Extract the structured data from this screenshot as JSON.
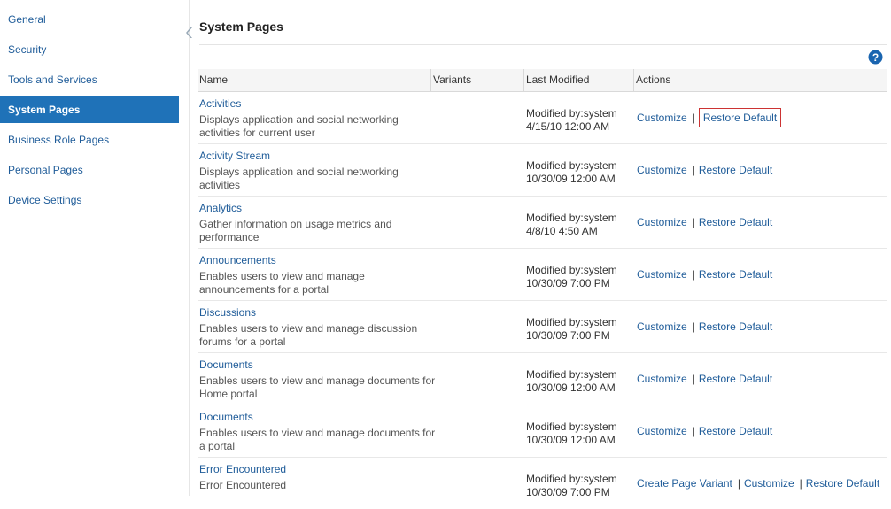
{
  "sidebar": {
    "items": [
      {
        "label": "General",
        "selected": false
      },
      {
        "label": "Security",
        "selected": false
      },
      {
        "label": "Tools and Services",
        "selected": false
      },
      {
        "label": "System Pages",
        "selected": true
      },
      {
        "label": "Business Role Pages",
        "selected": false
      },
      {
        "label": "Personal Pages",
        "selected": false
      },
      {
        "label": "Device Settings",
        "selected": false
      }
    ]
  },
  "main": {
    "title": "System Pages",
    "help_icon": "question-mark",
    "table": {
      "columns": [
        "Name",
        "Variants",
        "Last Modified",
        "Actions"
      ],
      "rows": [
        {
          "name": "Activities",
          "description": "Displays application and social networking activities for current user",
          "modified_by": "Modified by:system",
          "modified_date": "4/15/10 12:00 AM",
          "actions": [
            "Customize",
            "Restore Default"
          ]
        },
        {
          "name": "Activity Stream",
          "description": "Displays application and social networking activities",
          "modified_by": "Modified by:system",
          "modified_date": "10/30/09 12:00 AM",
          "actions": [
            "Customize",
            "Restore Default"
          ]
        },
        {
          "name": "Analytics",
          "description": "Gather information on usage metrics and performance",
          "modified_by": "Modified by:system",
          "modified_date": "4/8/10 4:50 AM",
          "actions": [
            "Customize",
            "Restore Default"
          ]
        },
        {
          "name": "Announcements",
          "description": "Enables users to view and manage announcements for a portal",
          "modified_by": "Modified by:system",
          "modified_date": "10/30/09 7:00 PM",
          "actions": [
            "Customize",
            "Restore Default"
          ]
        },
        {
          "name": "Discussions",
          "description": "Enables users to view and manage discussion forums for a portal",
          "modified_by": "Modified by:system",
          "modified_date": "10/30/09 7:00 PM",
          "actions": [
            "Customize",
            "Restore Default"
          ]
        },
        {
          "name": "Documents",
          "description": "Enables users to view and manage documents for Home portal",
          "modified_by": "Modified by:system",
          "modified_date": "10/30/09 12:00 AM",
          "actions": [
            "Customize",
            "Restore Default"
          ]
        },
        {
          "name": "Documents",
          "description": "Enables users to view and manage documents for a portal",
          "modified_by": "Modified by:system",
          "modified_date": "10/30/09 12:00 AM",
          "actions": [
            "Customize",
            "Restore Default"
          ]
        },
        {
          "name": "Error Encountered",
          "description": "Error Encountered",
          "modified_by": "Modified by:system",
          "modified_date": "10/30/09 7:00 PM",
          "actions": [
            "Create Page Variant",
            "Customize",
            "Restore Default"
          ]
        }
      ]
    },
    "highlighted_action": "Restore Default"
  },
  "colors": {
    "accent": "#1f72b8",
    "link": "#1f5c99",
    "highlight_border": "#cc3333"
  }
}
